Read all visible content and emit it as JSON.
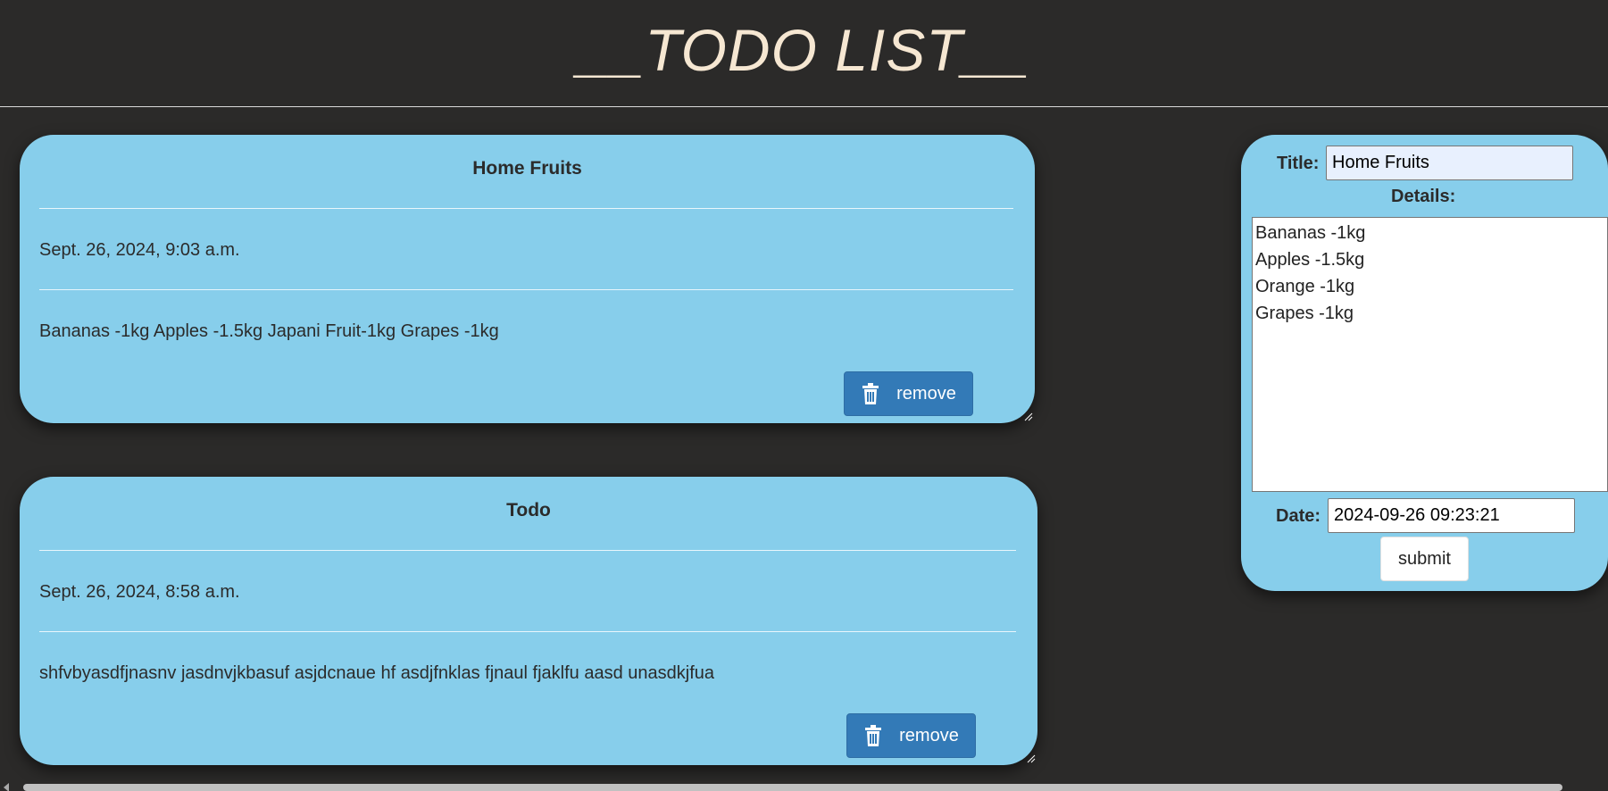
{
  "header": {
    "title": "__TODO LIST__"
  },
  "todos": [
    {
      "title": "Home Fruits",
      "date": "Sept. 26, 2024, 9:03 a.m.",
      "details": "Bananas -1kg Apples -1.5kg Japani Fruit-1kg Grapes -1kg",
      "remove_label": "remove"
    },
    {
      "title": "Todo",
      "date": "Sept. 26, 2024, 8:58 a.m.",
      "details": "shfvbyasdfjnasnv jasdnvjkbasuf asjdcnaue hf asdjfnklas fjnaul fjaklfu aasd unasdkjfua",
      "remove_label": "remove"
    }
  ],
  "form": {
    "title_label": "Title:",
    "title_value": "Home Fruits",
    "details_label": "Details:",
    "details_value": "Bananas -1kg\nApples -1.5kg\nOrange -1kg\nGrapes -1kg",
    "date_label": "Date:",
    "date_value": "2024-09-26 09:23:21",
    "submit_label": "submit"
  },
  "colors": {
    "background": "#2b2a29",
    "card": "#87ceeb",
    "header_text": "#f6e7d2",
    "remove_button": "#337ab7"
  },
  "icons": {
    "remove": "trash-icon"
  }
}
